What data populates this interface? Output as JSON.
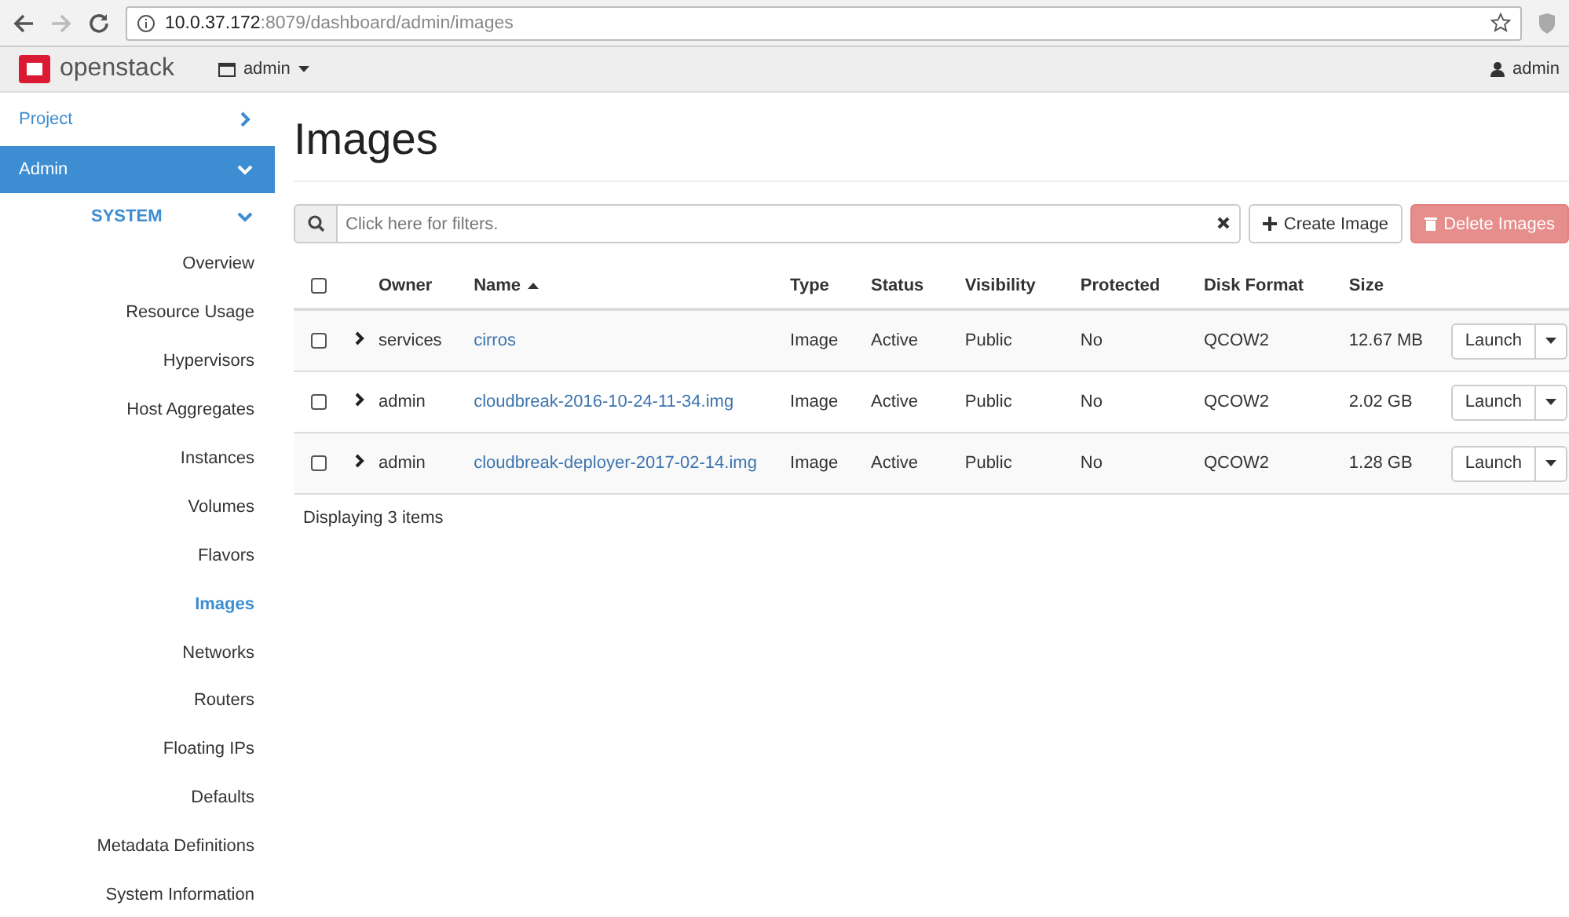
{
  "browser": {
    "url_host": "10.0.37.172",
    "url_path": ":8079/dashboard/admin/images"
  },
  "navbar": {
    "brand": "openstack",
    "project": "admin",
    "user": "admin"
  },
  "sidebar": {
    "items": [
      {
        "label": "Project",
        "kind": "panel",
        "expanded": false
      },
      {
        "label": "Admin",
        "kind": "panel",
        "expanded": true
      },
      {
        "label": "SYSTEM",
        "kind": "group",
        "expanded": true
      },
      {
        "label": "Overview",
        "kind": "link",
        "selected": false
      },
      {
        "label": "Resource Usage",
        "kind": "link",
        "selected": false
      },
      {
        "label": "Hypervisors",
        "kind": "link",
        "selected": false
      },
      {
        "label": "Host Aggregates",
        "kind": "link",
        "selected": false
      },
      {
        "label": "Instances",
        "kind": "link",
        "selected": false
      },
      {
        "label": "Volumes",
        "kind": "link",
        "selected": false
      },
      {
        "label": "Flavors",
        "kind": "link",
        "selected": false
      },
      {
        "label": "Images",
        "kind": "link",
        "selected": true
      },
      {
        "label": "Networks",
        "kind": "link",
        "selected": false
      },
      {
        "label": "Routers",
        "kind": "link",
        "selected": false
      },
      {
        "label": "Floating IPs",
        "kind": "link",
        "selected": false
      },
      {
        "label": "Defaults",
        "kind": "link",
        "selected": false
      },
      {
        "label": "Metadata Definitions",
        "kind": "link",
        "selected": false
      },
      {
        "label": "System Information",
        "kind": "link",
        "selected": false
      }
    ]
  },
  "page": {
    "title": "Images"
  },
  "filter": {
    "placeholder": "Click here for filters."
  },
  "buttons": [
    {
      "label": "Create Image",
      "kind": "create",
      "disabled": false
    },
    {
      "label": "Delete Images",
      "kind": "delete",
      "disabled": true
    }
  ],
  "table": {
    "all_checked": false,
    "columns": [
      "Owner",
      "Name",
      "Type",
      "Status",
      "Visibility",
      "Protected",
      "Disk Format",
      "Size"
    ],
    "rows": [
      {
        "checked": false,
        "owner": "services",
        "name": "cirros",
        "type": "Image",
        "status": "Active",
        "visibility": "Public",
        "protected": "No",
        "disk_format": "QCOW2",
        "size": "12.67 MB",
        "action": "Launch"
      },
      {
        "checked": false,
        "owner": "admin",
        "name": "cloudbreak-2016-10-24-11-34.img",
        "type": "Image",
        "status": "Active",
        "visibility": "Public",
        "protected": "No",
        "disk_format": "QCOW2",
        "size": "2.02 GB",
        "action": "Launch"
      },
      {
        "checked": false,
        "owner": "admin",
        "name": "cloudbreak-deployer-2017-02-14.img",
        "type": "Image",
        "status": "Active",
        "visibility": "Public",
        "protected": "No",
        "disk_format": "QCOW2",
        "size": "1.28 GB",
        "action": "Launch"
      }
    ],
    "footer": "Displaying 3 items"
  }
}
